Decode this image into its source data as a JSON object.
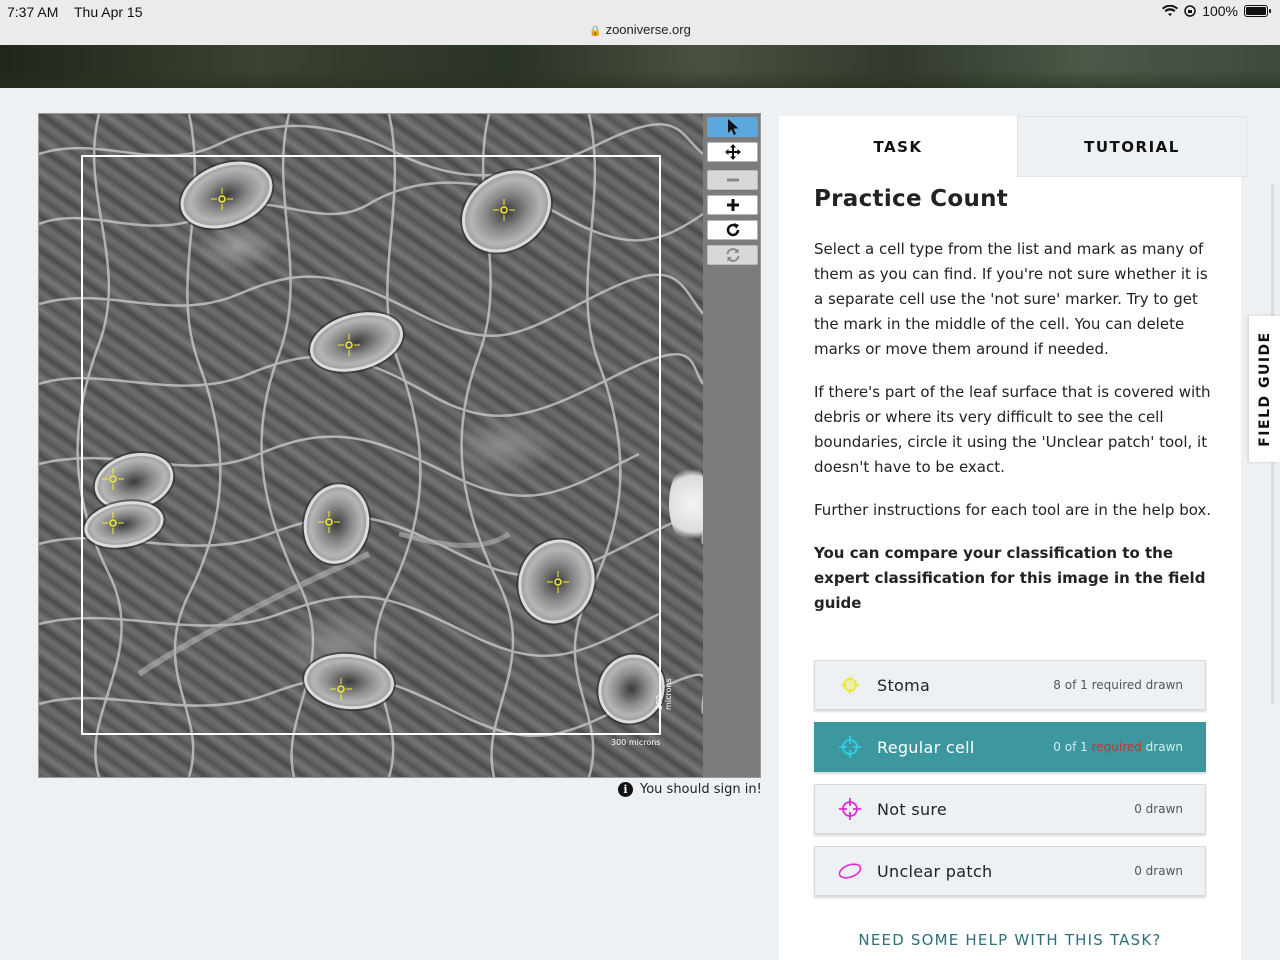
{
  "status_bar": {
    "time": "7:37 AM",
    "date": "Thu Apr 15",
    "battery": "100%",
    "url": "zooniverse.org"
  },
  "viewer": {
    "scale_label": "300 microns",
    "scale_label_vertical": "300 microns",
    "marker_color": "#f5ef2a",
    "signin_note": "You should sign in!"
  },
  "toolbar": {
    "select": "pointer-icon",
    "pan": "move-icon",
    "zoom_out": "minus-icon",
    "zoom_in": "plus-icon",
    "rotate": "rotate-icon",
    "reset": "reset-icon"
  },
  "task": {
    "tabs": [
      {
        "label": "TASK"
      },
      {
        "label": "TUTORIAL"
      }
    ],
    "title": "Practice Count",
    "paragraphs": [
      "Select a cell type from the list and mark as many of them as you can find. If you're not sure whether it is a separate cell use the 'not sure' marker. Try to get the mark in the middle of the cell. You can delete marks or move them around if needed.",
      "If there's part of the leaf surface that is covered with debris or where its very difficult to see the cell boundaries, circle it using the 'Unclear patch' tool, it doesn't have to be exact.",
      "Further instructions for each tool are in the help box.",
      "You can compare your classification to the expert classification for this image in the field guide"
    ],
    "tools": [
      {
        "label": "Stoma",
        "count_prefix": "8 of 1 ",
        "count_required": "required",
        "count_suffix": " drawn",
        "color": "#e8e82a"
      },
      {
        "label": "Regular cell",
        "count_prefix": "0 of 1 ",
        "count_required": "required",
        "count_suffix": " drawn",
        "color": "#2fd0e6"
      },
      {
        "label": "Not sure",
        "count_prefix": "0 drawn",
        "count_required": "",
        "count_suffix": "",
        "color": "#e22ad9"
      },
      {
        "label": "Unclear patch",
        "count_prefix": "0 drawn",
        "count_required": "",
        "count_suffix": "",
        "color": "#e22ad9"
      }
    ],
    "help_link": "NEED SOME HELP WITH THIS TASK?"
  },
  "field_guide": {
    "label": "FIELD GUIDE"
  },
  "colors": {
    "accent": "#3d979f",
    "active_tool": "#5ba7e0",
    "help_link": "#2c6f7a"
  }
}
